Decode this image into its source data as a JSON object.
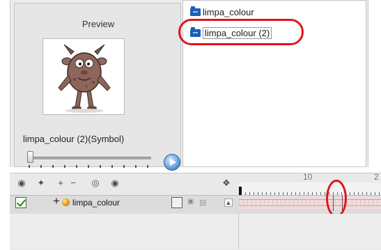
{
  "library": {
    "preview": {
      "title": "Preview",
      "symbol_label": "limpa_colour (2)(Symbol)",
      "slider_position": 0
    },
    "items": [
      {
        "name": "limpa_colour",
        "icon": "folder-icon",
        "selected": false
      },
      {
        "name": "limpa_colour (2)",
        "icon": "folder-icon",
        "selected": true
      }
    ]
  },
  "timeline": {
    "ruler_labels": [
      "10",
      "2"
    ],
    "toolbar_icons": [
      "add-drawing-layer-icon",
      "add-layer-icon",
      "add-remove-icon",
      "add-peg-icon",
      "onion-skin-icon",
      "center-icon",
      "fold-icon"
    ],
    "layer": {
      "name": "limpa_colour",
      "enabled": true
    }
  },
  "colors": {
    "highlight": "#e2131d",
    "folder": "#1e5fb2",
    "layer_track": "#f0dcdc",
    "checkbox": "#2e7d1a"
  }
}
